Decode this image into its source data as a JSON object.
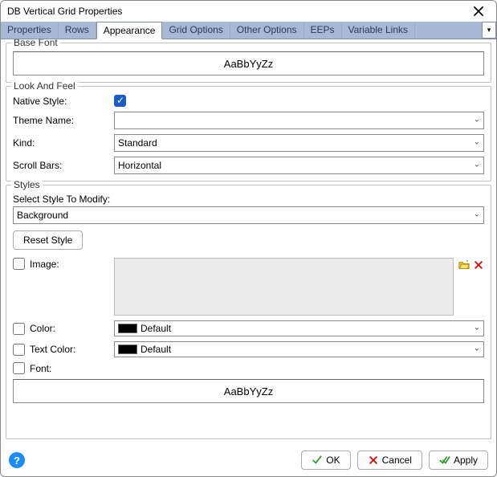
{
  "window": {
    "title": "DB Vertical Grid Properties"
  },
  "tabs": {
    "items": [
      "Properties",
      "Rows",
      "Appearance",
      "Grid Options",
      "Other Options",
      "EEPs",
      "Variable Links"
    ],
    "active_index": 2
  },
  "base_font": {
    "legend": "Base Font",
    "sample": "AaBbYyZz"
  },
  "look_and_feel": {
    "legend": "Look And Feel",
    "native_style": {
      "label": "Native Style:",
      "checked": true
    },
    "theme_name": {
      "label": "Theme Name:",
      "value": ""
    },
    "kind": {
      "label": "Kind:",
      "value": "Standard"
    },
    "scroll_bars": {
      "label": "Scroll Bars:",
      "value": "Horizontal"
    }
  },
  "styles": {
    "legend": "Styles",
    "select_label": "Select Style To Modify:",
    "selected_style": "Background",
    "reset_label": "Reset Style",
    "image": {
      "label": "Image:",
      "checked": false
    },
    "color": {
      "label": "Color:",
      "checked": false,
      "value": "Default"
    },
    "text_color": {
      "label": "Text Color:",
      "checked": false,
      "value": "Default"
    },
    "font": {
      "label": "Font:",
      "checked": false
    },
    "sample": "AaBbYyZz"
  },
  "buttons": {
    "ok": "OK",
    "cancel": "Cancel",
    "apply": "Apply"
  }
}
